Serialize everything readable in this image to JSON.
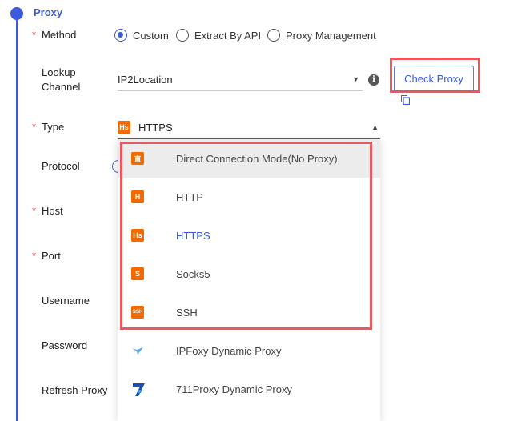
{
  "section": {
    "title": "Proxy"
  },
  "form": {
    "method": {
      "label": "Method",
      "required": true
    },
    "lookup": {
      "label_line1": "Lookup",
      "label_line2": "Channel",
      "value": "IP2Location",
      "info_glyph": "i"
    },
    "type": {
      "label": "Type",
      "required": true,
      "value": "HTTPS",
      "value_badge": "Hs"
    },
    "protocol": {
      "label": "Protocol"
    },
    "host": {
      "label": "Host",
      "required": true
    },
    "port": {
      "label": "Port",
      "required": true
    },
    "username": {
      "label": "Username"
    },
    "password": {
      "label": "Password"
    },
    "refresh": {
      "label": "Refresh Proxy"
    },
    "required_mark": "*"
  },
  "method_options": [
    {
      "label": "Custom",
      "selected": true
    },
    {
      "label": "Extract By API",
      "selected": false
    },
    {
      "label": "Proxy Management",
      "selected": false
    }
  ],
  "check_button": {
    "label": "Check Proxy"
  },
  "dropdown_options": [
    {
      "label": "Direct Connection Mode(No Proxy)",
      "badge": "直",
      "icon": "direct-icon"
    },
    {
      "label": "HTTP",
      "badge": "H",
      "icon": "http-icon"
    },
    {
      "label": "HTTPS",
      "badge": "Hs",
      "icon": "https-icon",
      "selected": true
    },
    {
      "label": "Socks5",
      "badge": "S",
      "icon": "socks5-icon"
    },
    {
      "label": "SSH",
      "badge": "SSH",
      "icon": "ssh-icon"
    },
    {
      "label": "IPFoxy Dynamic Proxy",
      "icon": "ipfoxy-logo-icon"
    },
    {
      "label": "711Proxy Dynamic Proxy",
      "icon": "711proxy-logo-icon"
    }
  ],
  "colors": {
    "accent": "#3b5bdb",
    "badge": "#f56a00",
    "highlight_border": "#e8585d",
    "required": "#e5484d"
  }
}
